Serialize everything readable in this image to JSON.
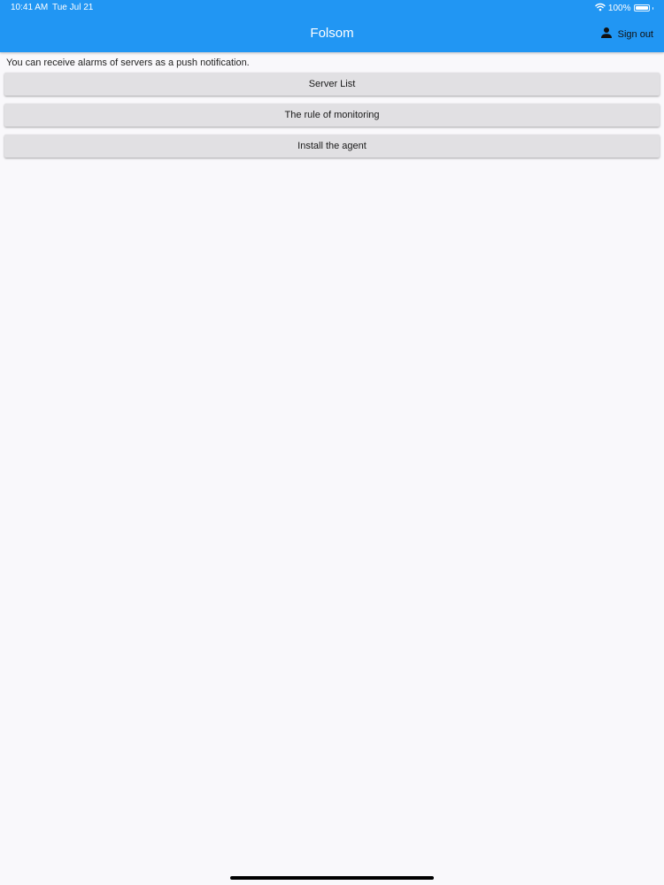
{
  "status_bar": {
    "time": "10:41 AM",
    "date": "Tue Jul 21",
    "battery_text": "100%",
    "battery_level": 1.0,
    "wifi_icon": "wifi-icon",
    "battery_icon": "battery-icon"
  },
  "app_bar": {
    "title": "Folsom",
    "signout_label": "Sign out",
    "signout_icon": "person-icon",
    "color": "#2196f3"
  },
  "main": {
    "intro_text": "You can receive alarms of servers as a push notification.",
    "buttons": [
      {
        "label": "Server List"
      },
      {
        "label": "The rule of monitoring"
      },
      {
        "label": "Install the agent"
      }
    ]
  }
}
